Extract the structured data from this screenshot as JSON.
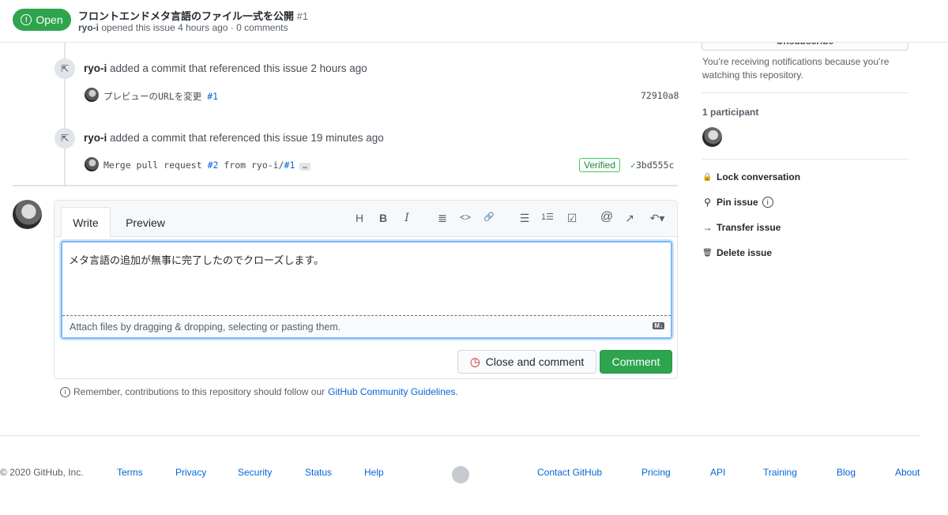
{
  "header": {
    "status": "Open",
    "title": "フロントエンドメタ言語のファイル一式を公開",
    "number": "#1",
    "author": "ryo-i",
    "meta": "opened this issue 4 hours ago · 0 comments"
  },
  "timeline": [
    {
      "actor": "ryo-i",
      "text": "added a commit that referenced this issue 2 hours ago",
      "commit_msg": "プレビューのURLを変更",
      "commit_ref": "#1",
      "sha": "72910a8"
    },
    {
      "actor": "ryo-i",
      "text": "added a commit that referenced this issue 19 minutes ago",
      "commit_msg_a": "Merge pull request",
      "commit_ref_a": "#2",
      "commit_msg_b": "from ryo-i/",
      "commit_ref_b": "#1",
      "ellipsis": "…",
      "verified": "Verified",
      "sha": "3bd555c"
    }
  ],
  "editor": {
    "tabs": [
      "Write",
      "Preview"
    ],
    "value": "メタ言語の追加が無事に完了したのでクローズします。",
    "attach": "Attach files by dragging & dropping, selecting or pasting them.",
    "md_badge": "M↓",
    "close_button": "Close and comment",
    "comment_button": "Comment",
    "toolbar": [
      "H",
      "B",
      "I",
      "≣",
      "<>",
      "🔗",
      "☰",
      "1☰",
      "☑",
      "@",
      "↗",
      "↶▾"
    ]
  },
  "note": {
    "text": "Remember, contributions to this repository should follow our",
    "link": "GitHub Community Guidelines",
    "end": "."
  },
  "sidebar": {
    "subscribe": "Unsubscribe",
    "notice": "You’re receiving notifications because you’re watching this repository.",
    "participants": "1 participant",
    "actions": [
      {
        "icon": "lock-icon",
        "glyph": "🔒",
        "label": "Lock conversation"
      },
      {
        "icon": "pin-icon",
        "glyph": "⚲",
        "label": "Pin issue"
      },
      {
        "icon": "arrow-right-icon",
        "glyph": "→",
        "label": "Transfer issue"
      },
      {
        "icon": "trash-icon",
        "glyph": "🗑",
        "label": "Delete issue"
      }
    ]
  },
  "footer": {
    "copyright": "© 2020 GitHub, Inc.",
    "links": [
      "Terms",
      "Privacy",
      "Security",
      "Status",
      "Help",
      "Contact GitHub",
      "Pricing",
      "API",
      "Training",
      "Blog",
      "About"
    ]
  },
  "colors": {
    "green": "#2ea44f",
    "link": "#0366d6",
    "danger": "#cb2431"
  }
}
